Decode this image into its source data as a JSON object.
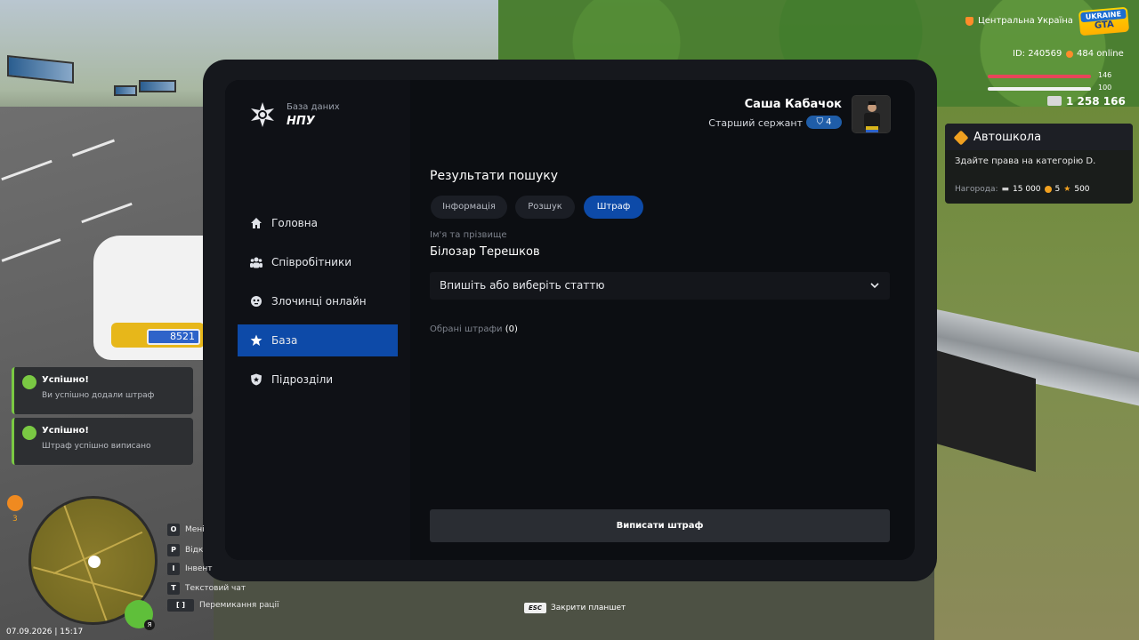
{
  "tablet": {
    "db_small": "База даних",
    "db_big": "НПУ",
    "nav": [
      {
        "label": "Головна"
      },
      {
        "label": "Співробітники"
      },
      {
        "label": "Злочинці онлайн"
      },
      {
        "label": "База"
      },
      {
        "label": "Підрозділи"
      }
    ],
    "active_nav": "База",
    "user": {
      "name": "Саша Кабачок",
      "rank": "Старший сержант",
      "rank_level": "4"
    },
    "results_title": "Результати пошуку",
    "tabs": [
      {
        "label": "Інформація"
      },
      {
        "label": "Розшук"
      },
      {
        "label": "Штраф"
      }
    ],
    "active_tab": "Штраф",
    "field_label": "Ім'я та прізвище",
    "field_value": "Білозар Терешков",
    "select_placeholder": "Впишіть або виберіть статтю",
    "chosen_label": "Обрані штрафи",
    "chosen_count": "(0)",
    "submit_label": "Виписати штраф"
  },
  "hud": {
    "region": "Центральна Україна",
    "logo_top": "UKRAINE",
    "logo_bottom": "GTA",
    "id": "ID: 240569",
    "online": "484 online",
    "health": "146",
    "armor": "100",
    "money": "1 258 166",
    "quest": {
      "title": "Автошкола",
      "desc": "Здайте права на категорію D.",
      "reward_label": "Нагорода:",
      "reward_money": "15 000",
      "reward_coins": "5",
      "reward_stars": "500"
    },
    "job_count": "3",
    "datetime": "07.09.2026 | 15:17",
    "mic_label": "Я",
    "plate": "8521"
  },
  "notifications": [
    {
      "title": "Успішно!",
      "desc": "Ви успішно додали штраф"
    },
    {
      "title": "Успішно!",
      "desc": "Штраф успішно виписано"
    }
  ],
  "keyhints": [
    {
      "key": "O",
      "label": "Мені"
    },
    {
      "key": "P",
      "label": "Відк"
    },
    {
      "key": "I",
      "label": "Інвент"
    },
    {
      "key": "T",
      "label": "Текстовий чат"
    },
    {
      "key": "[ ]",
      "label": "Перемикання рації"
    }
  ],
  "esc": {
    "key": "ESC",
    "label": "Закрити планшет"
  },
  "colors": {
    "accent": "#0d4aa8",
    "success": "#7ac943",
    "quest": "#f0a020"
  }
}
